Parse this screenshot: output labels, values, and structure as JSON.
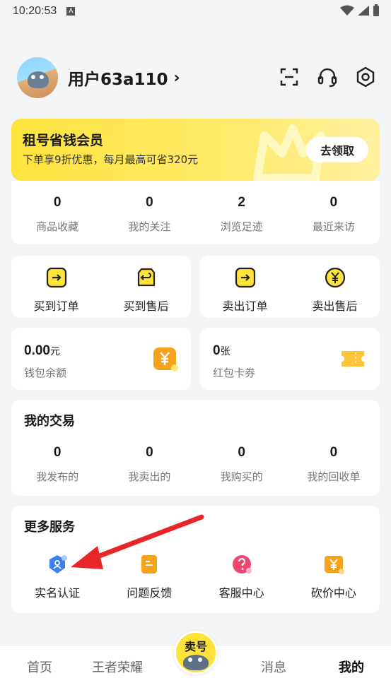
{
  "status_bar": {
    "time": "10:20:53"
  },
  "profile": {
    "username": "用户63a110",
    "chevron": "›"
  },
  "vip_banner": {
    "title": "租号省钱会员",
    "description": "下单享9折优惠，每月最高可省320元",
    "button": "去领取"
  },
  "stats": [
    {
      "value": "0",
      "label": "商品收藏"
    },
    {
      "value": "0",
      "label": "我的关注"
    },
    {
      "value": "2",
      "label": "浏览足迹"
    },
    {
      "value": "0",
      "label": "最近来访"
    }
  ],
  "buy_orders": [
    {
      "label": "买到订单",
      "icon": "order-arrow-icon"
    },
    {
      "label": "买到售后",
      "icon": "return-icon"
    }
  ],
  "sell_orders": [
    {
      "label": "卖出订单",
      "icon": "order-arrow-icon"
    },
    {
      "label": "卖出售后",
      "icon": "yen-circle-icon"
    }
  ],
  "wallet": {
    "amount": "0.00",
    "unit": "元",
    "label": "钱包余额"
  },
  "coupons": {
    "amount": "0",
    "unit": "张",
    "label": "红包卡券"
  },
  "my_trades": {
    "title": "我的交易",
    "items": [
      {
        "value": "0",
        "label": "我发布的"
      },
      {
        "value": "0",
        "label": "我卖出的"
      },
      {
        "value": "0",
        "label": "我购买的"
      },
      {
        "value": "0",
        "label": "我的回收单"
      }
    ]
  },
  "more_services": {
    "title": "更多服务",
    "items": [
      {
        "label": "实名认证",
        "icon": "shield-user-icon"
      },
      {
        "label": "问题反馈",
        "icon": "feedback-icon"
      },
      {
        "label": "客服中心",
        "icon": "help-icon"
      },
      {
        "label": "砍价中心",
        "icon": "yen-tag-icon"
      }
    ]
  },
  "tabbar": {
    "home": "首页",
    "game": "王者荣耀",
    "center": "卖号",
    "messages": "消息",
    "mine": "我的"
  },
  "colors": {
    "accent_yellow": "#ffe23a",
    "arrow_red": "#e8262a",
    "shield_blue": "#3d7ff2",
    "help_pink": "#f0476e",
    "orange": "#f7a21b"
  }
}
